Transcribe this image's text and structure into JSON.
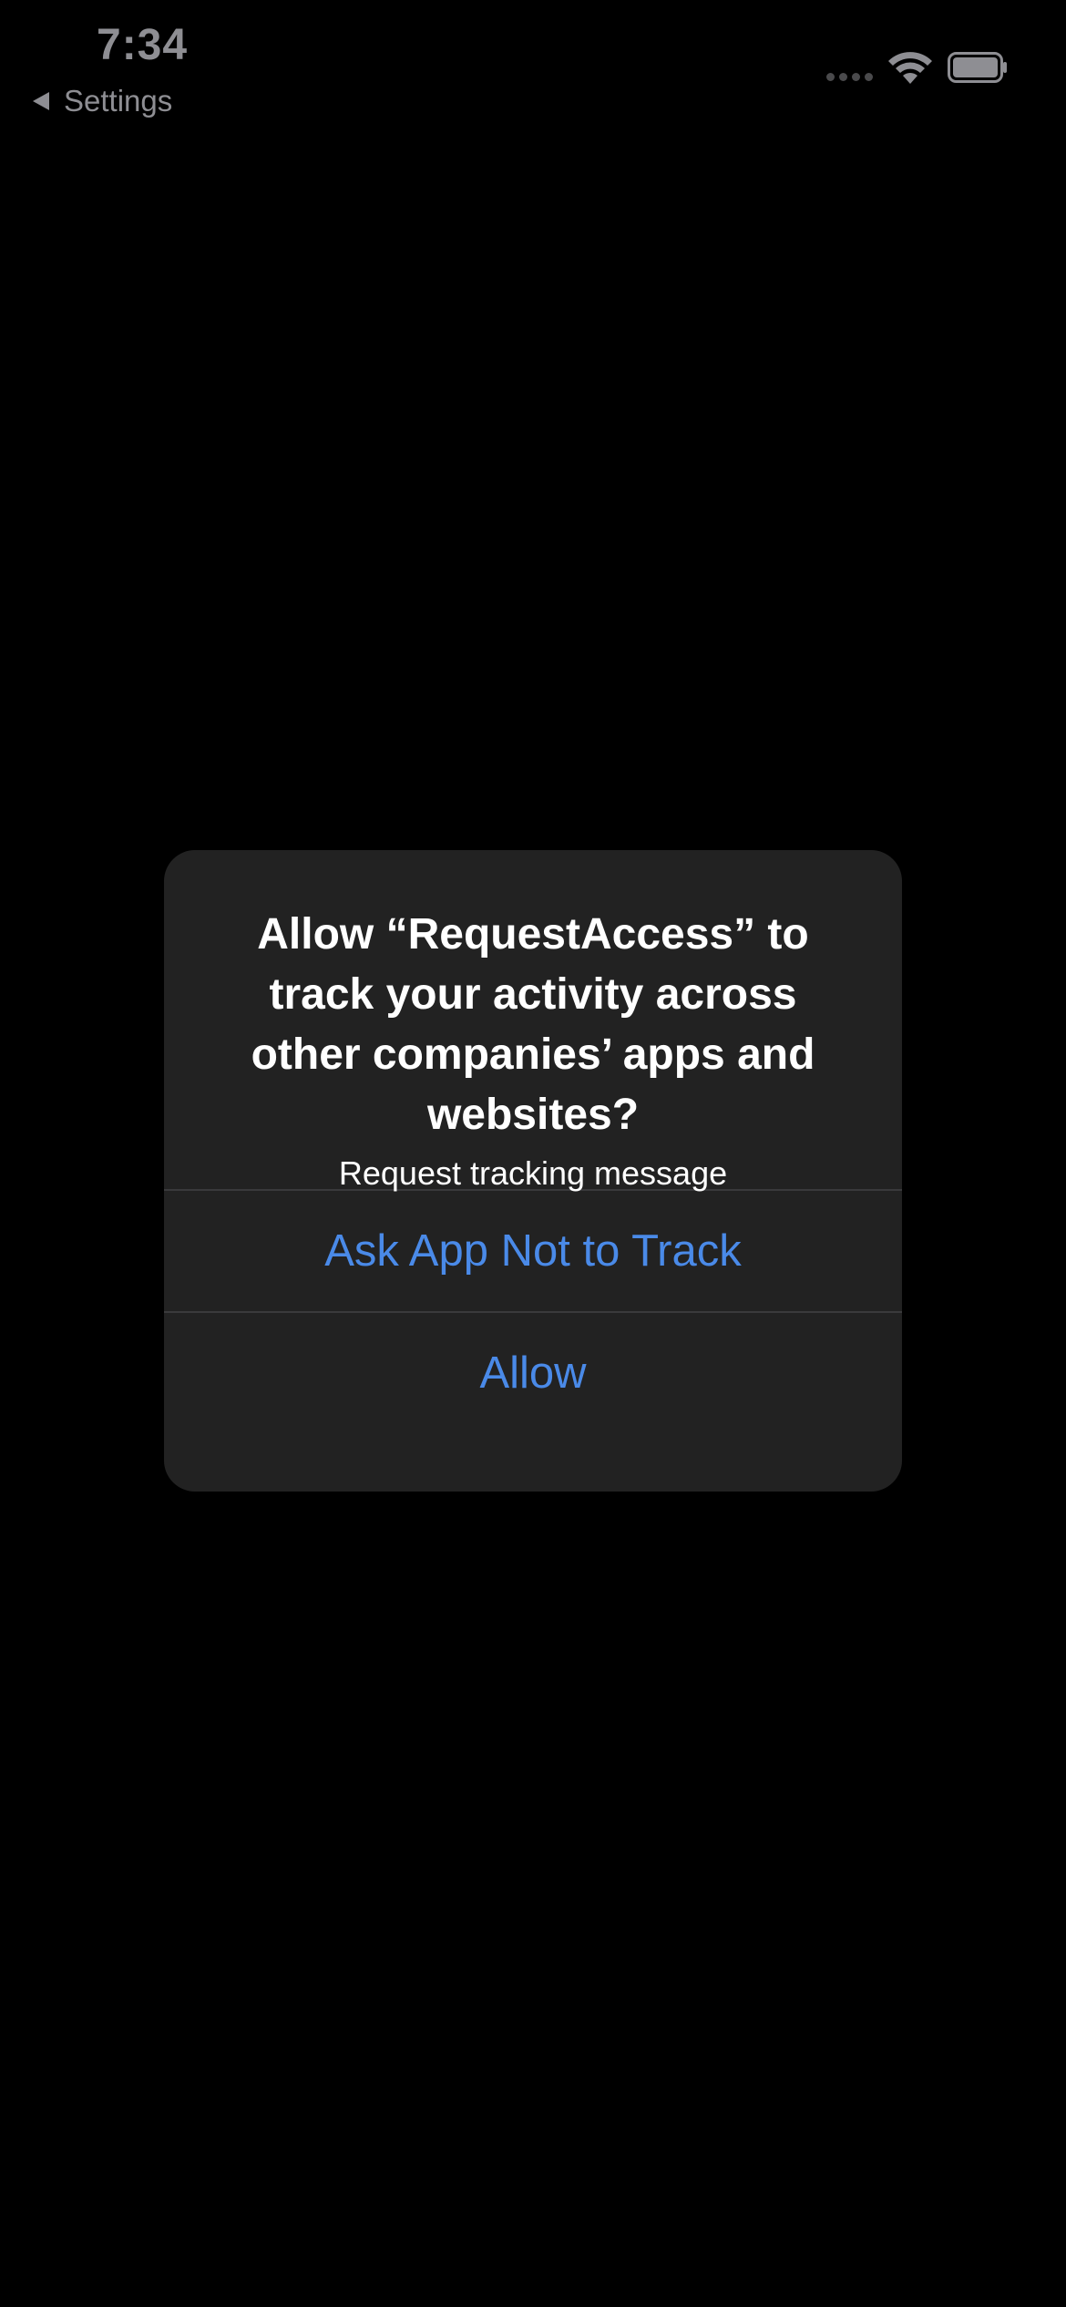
{
  "status_bar": {
    "time": "7:34",
    "back_label": "Settings",
    "icons": [
      "signal-icon",
      "wifi-icon",
      "battery-icon"
    ]
  },
  "alert": {
    "title": "Allow “RequestAccess” to track your activity across other companies’ apps and websites?",
    "message": "Request tracking message",
    "buttons": [
      {
        "label": "Ask App Not to Track"
      },
      {
        "label": "Allow"
      }
    ]
  },
  "colors": {
    "background": "#000000",
    "alert_background": "#222222",
    "button_text": "#4a8ae8",
    "status_text": "#8e8e93"
  }
}
